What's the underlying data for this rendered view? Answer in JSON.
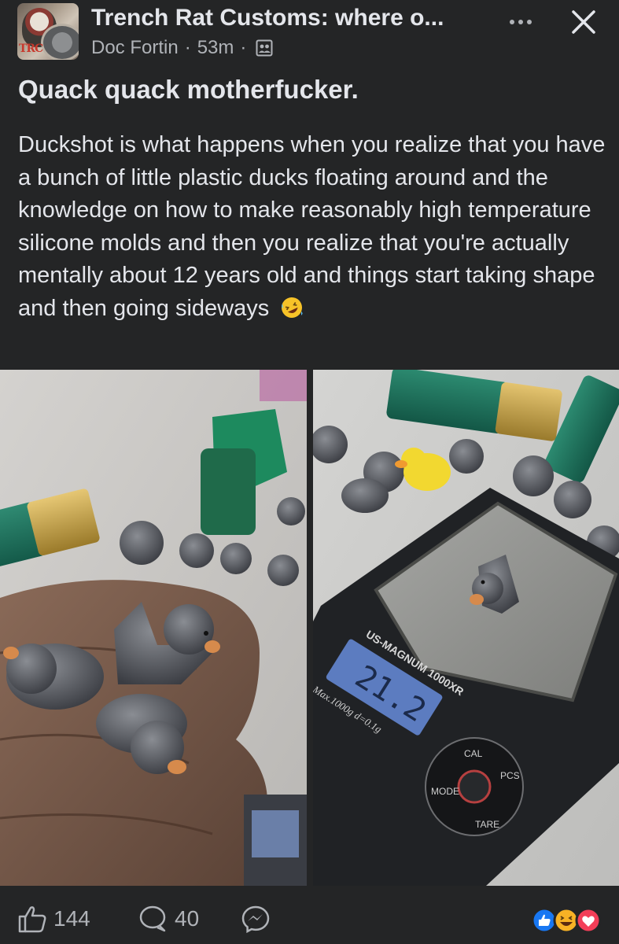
{
  "header": {
    "page_name": "Trench Rat Customs: where o...",
    "author": "Doc Fortin",
    "separator": "·",
    "time": "53m",
    "privacy_icon": "group-privacy-icon",
    "more_icon": "more-options-icon",
    "close_icon": "close-icon",
    "avatar_text": "TRC"
  },
  "post": {
    "title": "Quack quack motherfucker.",
    "body": "Duckshot is what happens when you realize that you have a bunch of little plastic ducks floating around and the knowledge on how to make reasonably high temperature silicone molds and then you realize that you're actually mentally about 12 years old and things start taking shape and then going sideways",
    "emoji": "rolling-on-floor-laughing-emoji"
  },
  "photos": {
    "left": {
      "subject": "lead-duck-castings-in-hand"
    },
    "right": {
      "subject": "lead-duck-on-digital-scale",
      "scale_brand": "US-MAGNUM 1000XR",
      "scale_spec": "Max.1000g d=0.1g",
      "display_value": "21.2",
      "buttons": [
        "CAL",
        "PCS",
        "TARE",
        "MODE"
      ]
    }
  },
  "footer": {
    "like_count": "144",
    "comment_count": "40",
    "like_icon": "thumbs-up-icon",
    "comment_icon": "comment-bubble-icon",
    "share_icon": "messenger-icon",
    "reactions": [
      "like-reaction-icon",
      "haha-reaction-icon",
      "love-reaction-icon"
    ]
  },
  "colors": {
    "background": "#242526",
    "primary_text": "#e4e6eb",
    "secondary_text": "#b0b3b8",
    "like_blue": "#1877f2",
    "love_red": "#f33e58",
    "haha_yellow": "#f7b125"
  }
}
